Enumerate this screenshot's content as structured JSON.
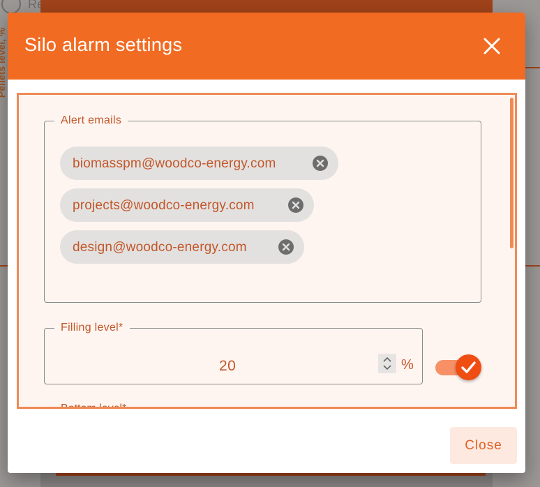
{
  "background": {
    "clock_text": "Re",
    "axis_label": "Pellets level, %"
  },
  "dialog": {
    "title": "Silo alarm settings",
    "close_icon": "close-icon",
    "accent_color": "#f26b22"
  },
  "alert_emails": {
    "legend": "Alert emails",
    "chips": [
      {
        "label": "biomasspm@woodco-energy.com"
      },
      {
        "label": "projects@woodco-energy.com"
      },
      {
        "label": "design@woodco-energy.com"
      }
    ]
  },
  "filling_level": {
    "legend": "Filling level*",
    "value": "20",
    "unit": "%",
    "enabled": true
  },
  "bottom_level": {
    "legend": "Bottom level*"
  },
  "footer": {
    "close_label": "Close"
  }
}
